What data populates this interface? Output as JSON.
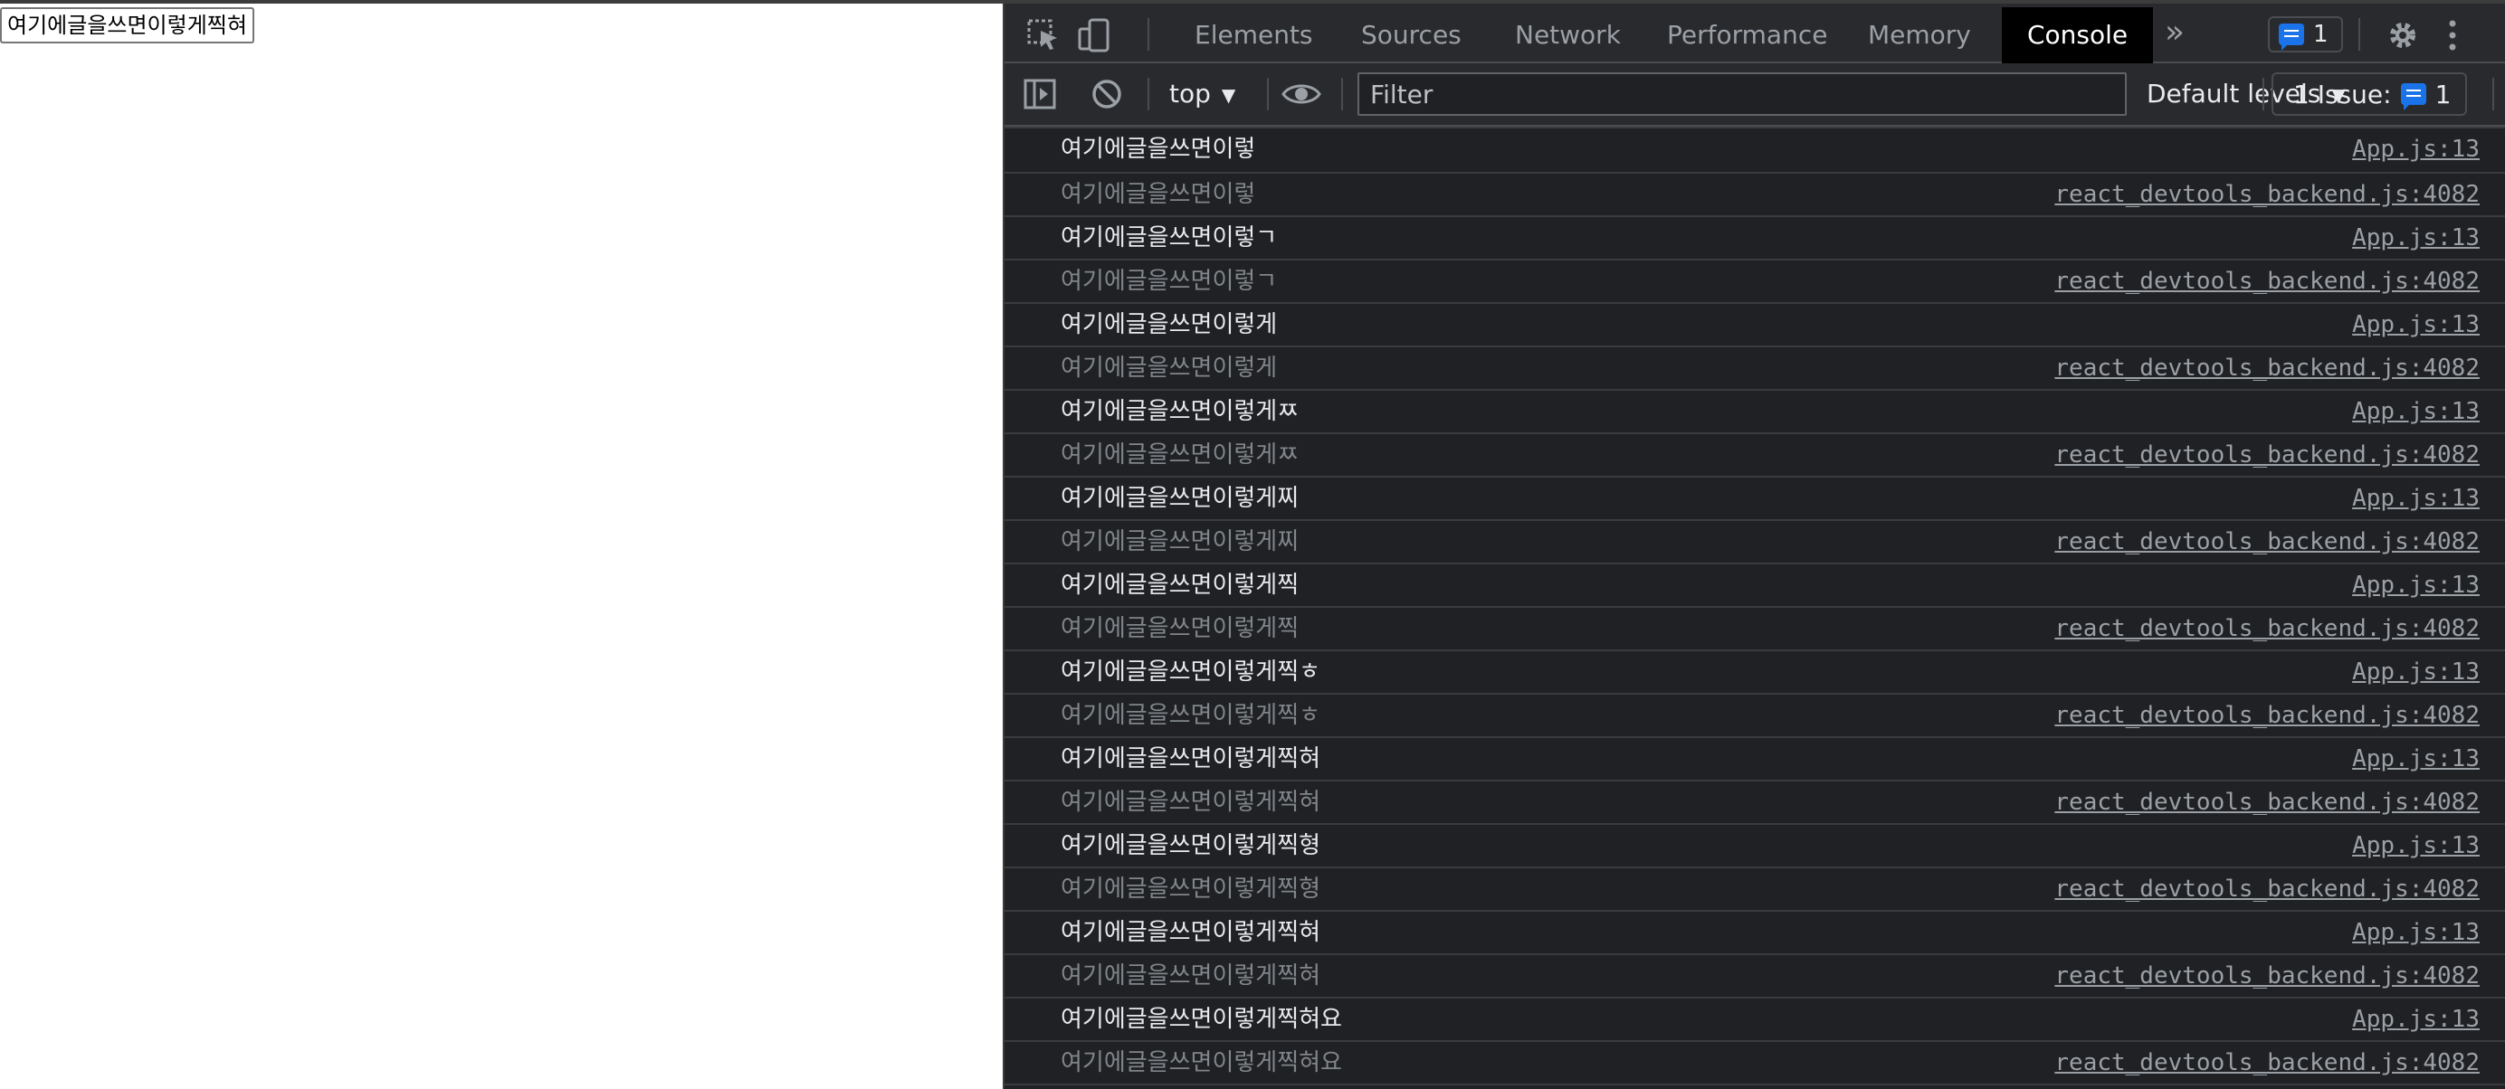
{
  "page": {
    "input_value": "여기에글을쓰면이렇게찍혀"
  },
  "devtools": {
    "tabs": [
      {
        "label": "Elements",
        "active": false
      },
      {
        "label": "Sources",
        "active": false
      },
      {
        "label": "Network",
        "active": false
      },
      {
        "label": "Performance",
        "active": false
      },
      {
        "label": "Memory",
        "active": false
      },
      {
        "label": "Console",
        "active": true
      }
    ],
    "more_tabs_icon": "chevron-double-right-icon",
    "message_badge_count": "1",
    "settings_icon": "gear-icon",
    "menu_icon": "kebab-menu-icon",
    "toolbar": {
      "context": "top",
      "filter_placeholder": "Filter",
      "levels": "Default levels",
      "issues_label": "1 Issue:",
      "issues_count": "1"
    },
    "colors": {
      "panel_bg": "#202124",
      "accent_blue": "#1a73e8",
      "active_tab_bg": "#000000"
    },
    "logs": [
      {
        "text": "여기에글을쓰면이렇",
        "source": "App.js:13",
        "dim": false
      },
      {
        "text": "여기에글을쓰면이렇",
        "source": "react_devtools_backend.js:4082",
        "dim": true
      },
      {
        "text": "여기에글을쓰면이렇ㄱ",
        "source": "App.js:13",
        "dim": false
      },
      {
        "text": "여기에글을쓰면이렇ㄱ",
        "source": "react_devtools_backend.js:4082",
        "dim": true
      },
      {
        "text": "여기에글을쓰면이렇게",
        "source": "App.js:13",
        "dim": false
      },
      {
        "text": "여기에글을쓰면이렇게",
        "source": "react_devtools_backend.js:4082",
        "dim": true
      },
      {
        "text": "여기에글을쓰면이렇게ㅉ",
        "source": "App.js:13",
        "dim": false
      },
      {
        "text": "여기에글을쓰면이렇게ㅉ",
        "source": "react_devtools_backend.js:4082",
        "dim": true
      },
      {
        "text": "여기에글을쓰면이렇게찌",
        "source": "App.js:13",
        "dim": false
      },
      {
        "text": "여기에글을쓰면이렇게찌",
        "source": "react_devtools_backend.js:4082",
        "dim": true
      },
      {
        "text": "여기에글을쓰면이렇게찍",
        "source": "App.js:13",
        "dim": false
      },
      {
        "text": "여기에글을쓰면이렇게찍",
        "source": "react_devtools_backend.js:4082",
        "dim": true
      },
      {
        "text": "여기에글을쓰면이렇게찍ㅎ",
        "source": "App.js:13",
        "dim": false
      },
      {
        "text": "여기에글을쓰면이렇게찍ㅎ",
        "source": "react_devtools_backend.js:4082",
        "dim": true
      },
      {
        "text": "여기에글을쓰면이렇게찍혀",
        "source": "App.js:13",
        "dim": false
      },
      {
        "text": "여기에글을쓰면이렇게찍혀",
        "source": "react_devtools_backend.js:4082",
        "dim": true
      },
      {
        "text": "여기에글을쓰면이렇게찍형",
        "source": "App.js:13",
        "dim": false
      },
      {
        "text": "여기에글을쓰면이렇게찍형",
        "source": "react_devtools_backend.js:4082",
        "dim": true
      },
      {
        "text": "여기에글을쓰면이렇게찍혀",
        "source": "App.js:13",
        "dim": false
      },
      {
        "text": "여기에글을쓰면이렇게찍혀",
        "source": "react_devtools_backend.js:4082",
        "dim": true
      },
      {
        "text": "여기에글을쓰면이렇게찍혀요",
        "source": "App.js:13",
        "dim": false
      },
      {
        "text": "여기에글을쓰면이렇게찍혀요",
        "source": "react_devtools_backend.js:4082",
        "dim": true
      }
    ]
  }
}
